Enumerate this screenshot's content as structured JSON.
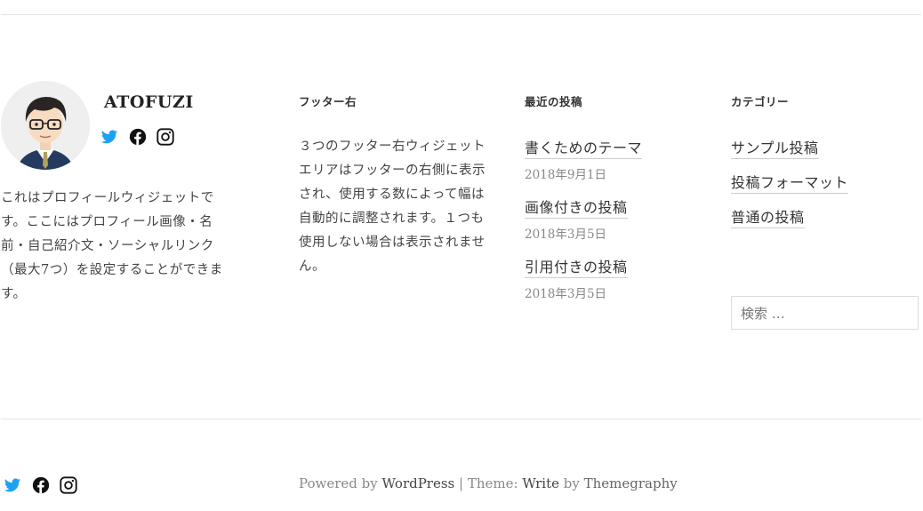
{
  "profile": {
    "name": "ATOFUZI",
    "text": "これはプロフィールウィジェットです。ここにはプロフィール画像・名前・自己紹介文・ソーシャルリンク（最大7つ）を設定することができます。",
    "social_icons": [
      "twitter-icon",
      "facebook-icon",
      "instagram-icon"
    ]
  },
  "footer_right": {
    "title": "フッター右",
    "text": "３つのフッター右ウィジェットエリアはフッターの右側に表示され、使用する数によって幅は自動的に調整されます。１つも使用しない場合は表示されません。"
  },
  "recent_posts": {
    "title": "最近の投稿",
    "items": [
      {
        "title": "書くためのテーマ",
        "date": "2018年9月1日"
      },
      {
        "title": "画像付きの投稿",
        "date": "2018年3月5日"
      },
      {
        "title": "引用付きの投稿",
        "date": "2018年3月5日"
      }
    ]
  },
  "categories": {
    "title": "カテゴリー",
    "items": [
      "サンプル投稿",
      "投稿フォーマット",
      "普通の投稿"
    ]
  },
  "search": {
    "placeholder": "検索 …"
  },
  "footer": {
    "powered_by": "Powered by",
    "wordpress": "WordPress",
    "separator": "|",
    "theme_label": "Theme:",
    "theme_name": "Write",
    "by": "by",
    "author": "Themegraphy"
  },
  "colors": {
    "twitter": "#1da1f2",
    "text": "#333333",
    "muted": "#888888"
  }
}
